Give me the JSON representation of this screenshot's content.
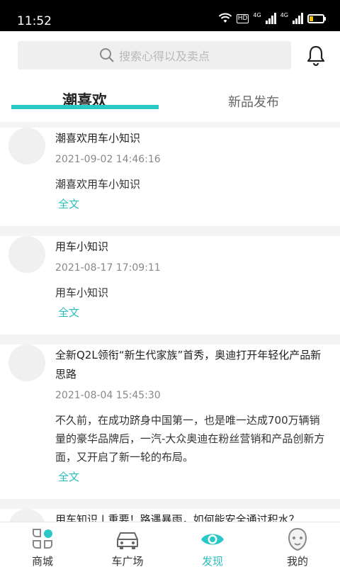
{
  "status_bar": {
    "time": "11:52",
    "hd_badge": "HD",
    "net1": "4G",
    "net2": "4G"
  },
  "header": {
    "search_placeholder": "搜索心得以及卖点",
    "tabs": [
      {
        "label": "潮喜欢",
        "active": true
      },
      {
        "label": "新品发布",
        "active": false
      }
    ]
  },
  "feed": {
    "items": [
      {
        "title": "潮喜欢用车小知识",
        "date": "2021-09-02 14:46:16",
        "body": "潮喜欢用车小知识",
        "more": "全文"
      },
      {
        "title": "用车小知识",
        "date": "2021-08-17 17:09:11",
        "body": "用车小知识",
        "more": "全文"
      },
      {
        "title": "全新Q2L领衔“新生代家族”首秀，奥迪打开年轻化产品新思路",
        "date": "2021-08-04 15:45:30",
        "body": "不久前，在成功跻身中国第一，也是唯一达成700万辆销量的豪华品牌后，一汽-大众奥迪在粉丝营销和产品创新方面，又开启了新一轮的布局。",
        "more": "全文"
      },
      {
        "title": "用车知识 | 重要！路遇暴雨，如何能安全通过积水？",
        "date": "",
        "body": "",
        "more": ""
      }
    ]
  },
  "tabbar": {
    "items": [
      {
        "label": "商城",
        "icon": "mall-icon"
      },
      {
        "label": "车广场",
        "icon": "car-icon"
      },
      {
        "label": "发现",
        "icon": "eye-icon",
        "active": true
      },
      {
        "label": "我的",
        "icon": "profile-icon"
      }
    ]
  },
  "colors": {
    "accent": "#2bc8c8",
    "link": "#2bbdbd",
    "status_bar": "#000000",
    "battery": "#f5c400"
  }
}
